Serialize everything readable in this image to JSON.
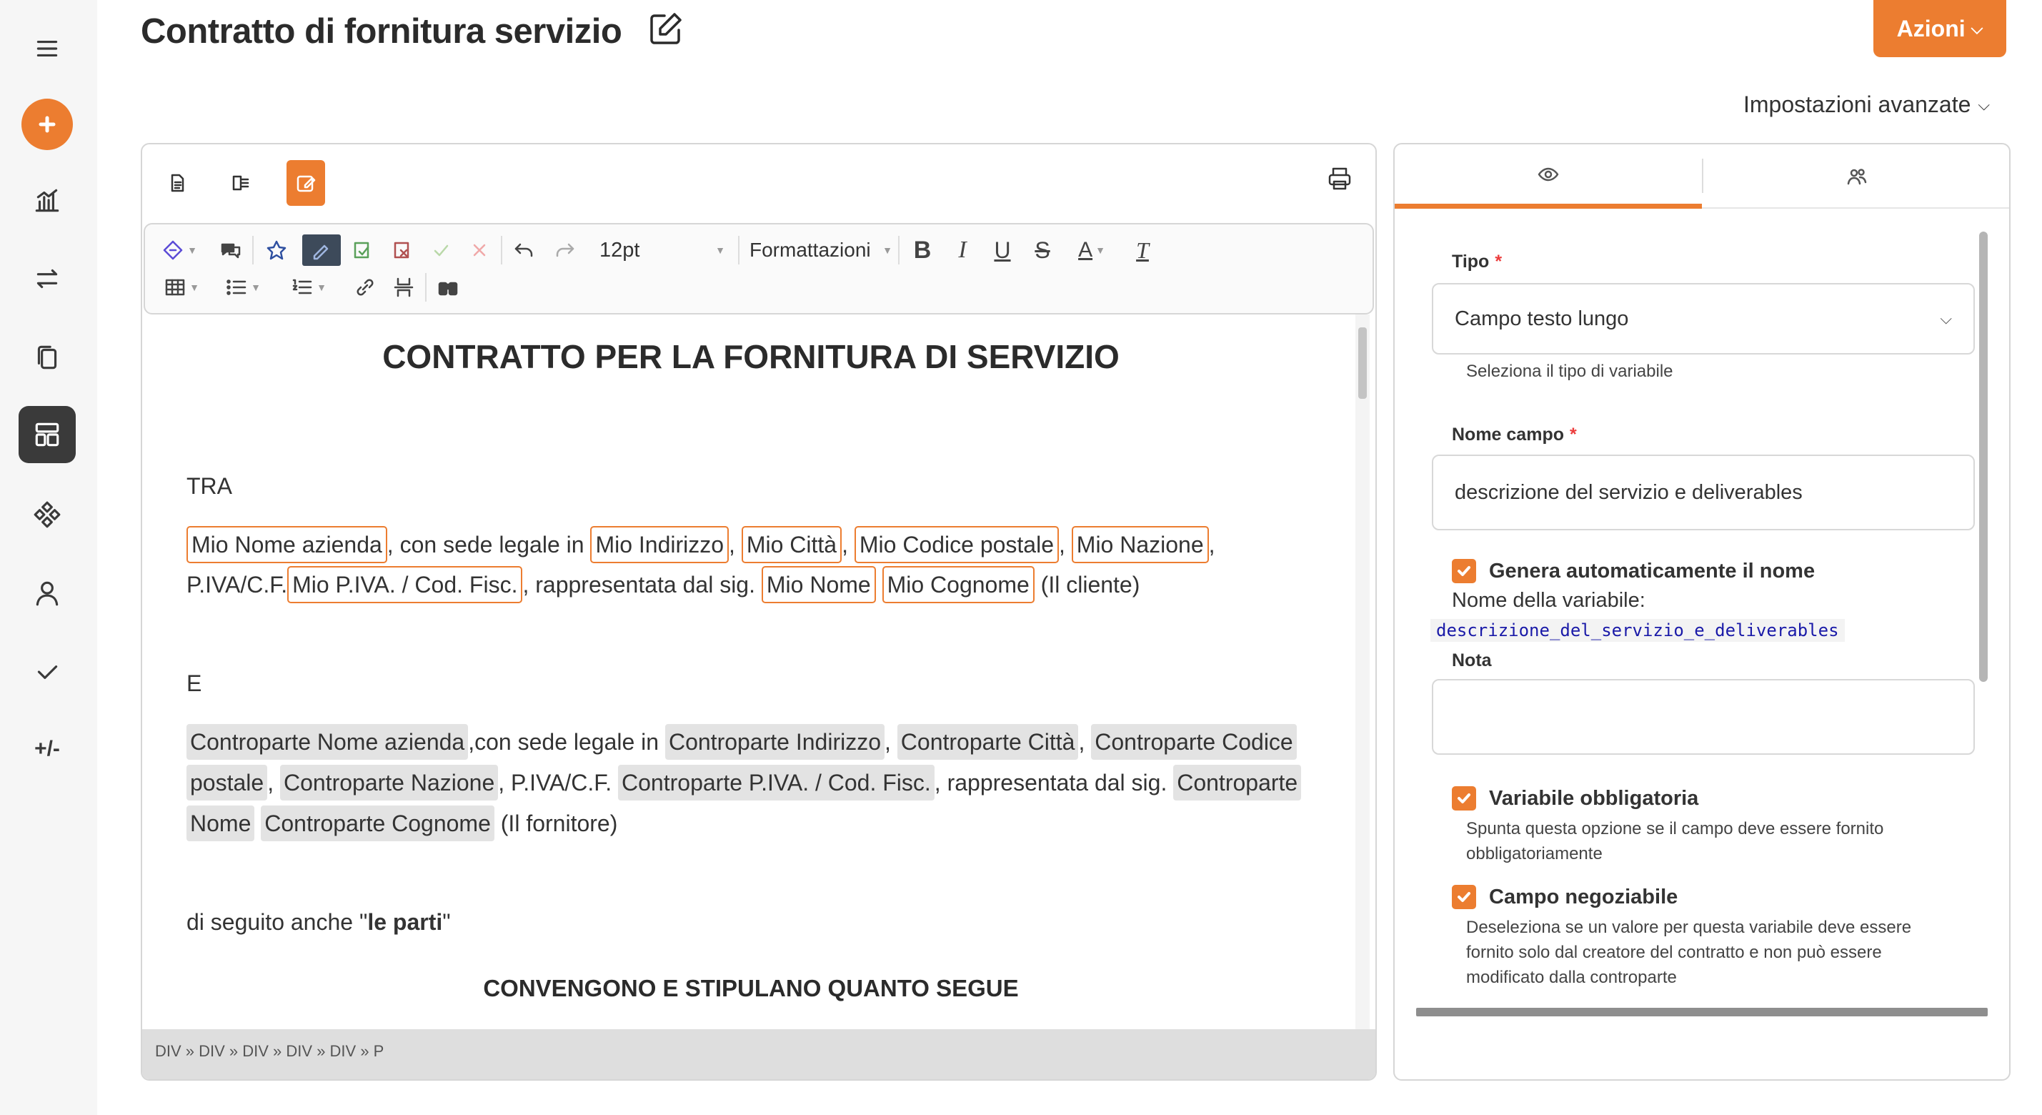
{
  "header": {
    "title": "Contratto di fornitura servizio",
    "actions_label": "Azioni",
    "advanced_settings_label": "Impostazioni avanzate"
  },
  "rail": {
    "items": [
      "menu-icon",
      "add-icon",
      "chart-icon",
      "transfer-icon",
      "copy-icon",
      "templates-icon",
      "components-icon",
      "user-icon",
      "check-icon",
      "plus-minus"
    ],
    "plus_minus_label": "+/-",
    "active": "templates-icon"
  },
  "editor": {
    "font_size": "12pt",
    "format_label": "Formattazioni",
    "status_path": "DIV » DIV » DIV » DIV » DIV » P",
    "document": {
      "title": "CONTRATTO PER LA FORNITURA DI SERVIZIO",
      "tra": "TRA",
      "party1": {
        "company": "Mio Nome azienda",
        "t_sede": ", con sede legale in ",
        "address": "Mio Indirizzo",
        "city": "Mio Città",
        "zip": "Mio Codice postale",
        "country": "Mio Nazione",
        "t_piva": "P.IVA/C.F.",
        "vat": "Mio P.IVA. / Cod. Fisc.",
        "t_rapp": ", rappresentata dal sig. ",
        "name": "Mio Nome",
        "surname": "Mio Cognome",
        "t_role": " (Il cliente)"
      },
      "e": "E",
      "party2": {
        "company": "Controparte Nome azienda",
        "t_sede": ",con sede legale in ",
        "address": "Controparte Indirizzo",
        "city": "Controparte Città",
        "zip_a": "Controparte Codice",
        "zip_b": "postale",
        "country": "Controparte Nazione",
        "t_piva": ", P.IVA/C.F. ",
        "vat": "Controparte P.IVA. / Cod. Fisc.",
        "t_rapp": ", rappresentata dal sig. ",
        "name_a": "Controparte",
        "name_b": "Nome",
        "surname": "Controparte Cognome",
        "t_role": " (Il fornitore)"
      },
      "parties_prefix": "di seguito anche \"",
      "parties_bold": "le parti",
      "parties_suffix": "\"",
      "agree": "CONVENGONO E STIPULANO QUANTO SEGUE"
    }
  },
  "side": {
    "tipo_label": "Tipo",
    "tipo_value": "Campo testo lungo",
    "tipo_help": "Seleziona il tipo di variabile",
    "nome_label": "Nome campo",
    "nome_value": "descrizione del servizio e deliverables",
    "genera_label": "Genera automaticamente il nome",
    "var_name_label": "Nome della variabile:",
    "var_name_value": "descrizione_del_servizio_e_deliverables",
    "nota_label": "Nota",
    "nota_value": "",
    "obbl_label": "Variabile obbligatoria",
    "obbl_help": "Spunta questa opzione se il campo deve essere fornito obbligatoriamente",
    "neg_label": "Campo negoziabile",
    "neg_help": "Deseleziona se un valore per questa variabile deve essere fornito solo dal creatore del contratto e non può essere modificato dalla controparte",
    "required_mark": "*"
  },
  "colors": {
    "accent": "#ec7d30",
    "rail_bg": "#f6f6f6",
    "active_rail": "#3a3a3a"
  }
}
